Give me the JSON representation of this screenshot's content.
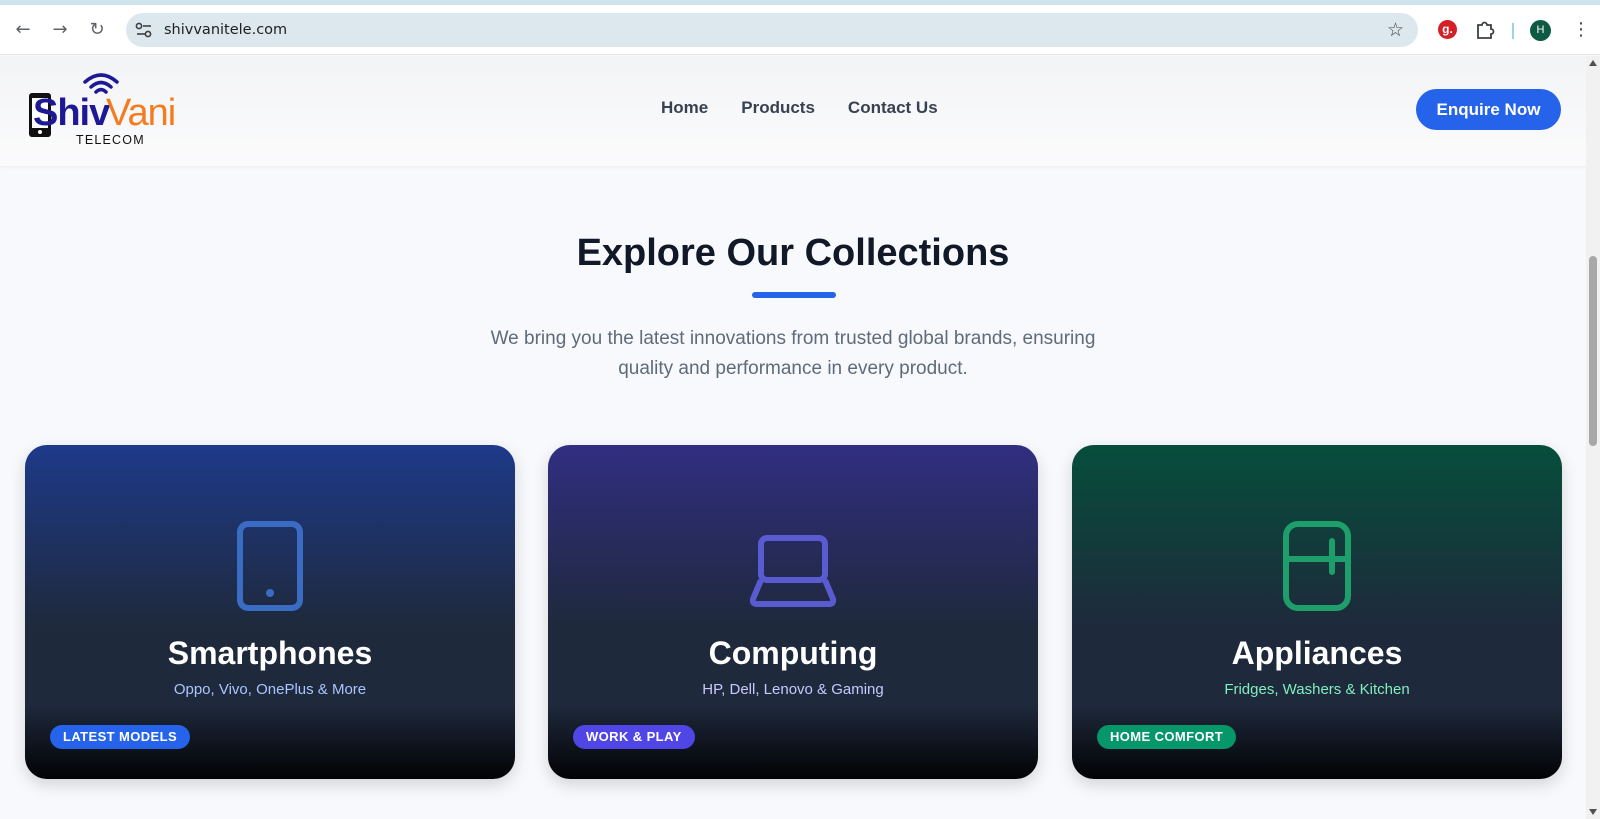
{
  "browser": {
    "url": "shivvanitele.com",
    "profile_initial": "H",
    "extension_label": "g."
  },
  "header": {
    "logo": {
      "shiv": "Shiv",
      "vani": "Vani",
      "telecom": "TELECOM"
    },
    "nav": [
      "Home",
      "Products",
      "Contact Us"
    ],
    "cta": "Enquire Now"
  },
  "section": {
    "title": "Explore Our Collections",
    "subtitle": "We bring you the latest innovations from trusted global brands, ensuring quality and performance in every product."
  },
  "cards": [
    {
      "title": "Smartphones",
      "subtitle": "Oppo, Vivo, OnePlus & More",
      "badge": "LATEST MODELS",
      "icon": "smartphone-icon",
      "accent": "#3b6cc4",
      "sub_color": "#a9c4ff",
      "badge_color": "#2563eb"
    },
    {
      "title": "Computing",
      "subtitle": "HP, Dell, Lenovo & Gaming",
      "badge": "WORK & PLAY",
      "icon": "laptop-icon",
      "accent": "#5a5bd0",
      "sub_color": "#c7c9ff",
      "badge_color": "#4f46e5"
    },
    {
      "title": "Appliances",
      "subtitle": "Fridges, Washers & Kitchen",
      "badge": "HOME COMFORT",
      "icon": "fridge-icon",
      "accent": "#1e9e6b",
      "sub_color": "#7ff0c0",
      "badge_color": "#059669"
    }
  ],
  "colors": {
    "primary": "#2563eb",
    "brand_blue": "#1c1896",
    "brand_orange": "#f47c20"
  }
}
